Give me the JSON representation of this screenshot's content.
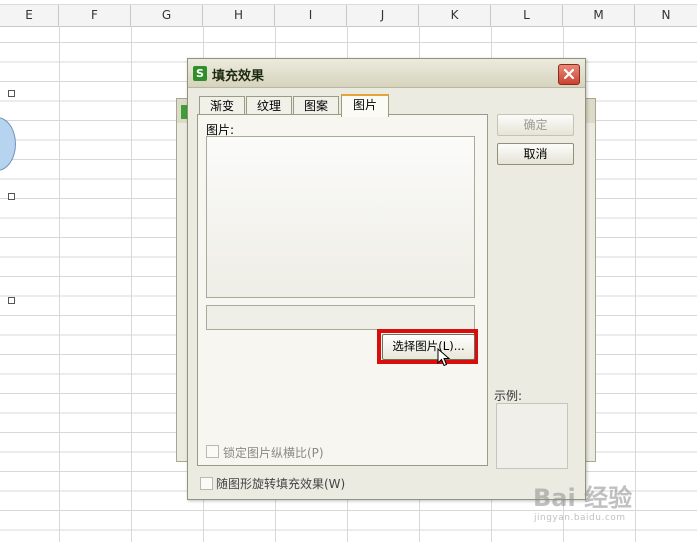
{
  "sheet": {
    "columns": [
      "E",
      "F",
      "G",
      "H",
      "I",
      "J",
      "K",
      "L",
      "M",
      "N"
    ]
  },
  "dialog": {
    "app_logo": "S",
    "title": "填充效果",
    "close_icon": "close-x-icon",
    "tabs": [
      {
        "label": "渐变",
        "active": false
      },
      {
        "label": "纹理",
        "active": false
      },
      {
        "label": "图案",
        "active": false
      },
      {
        "label": "图片",
        "active": true
      }
    ],
    "picture_label": "图片:",
    "select_picture_button": "选择图片(L)...",
    "lock_ratio_label": "锁定图片纵横比(P)",
    "rotate_with_shape_label": "随图形旋转填充效果(W)",
    "ok_button": "确定",
    "cancel_button": "取消",
    "sample_label": "示例:"
  },
  "colors": {
    "highlight": "#d80d0d",
    "active_tab_accent": "#e3a53a",
    "logo_green": "#2f8f2a"
  },
  "watermark": {
    "text": "Bai 经验",
    "sub": "jingyan.baidu.com"
  }
}
